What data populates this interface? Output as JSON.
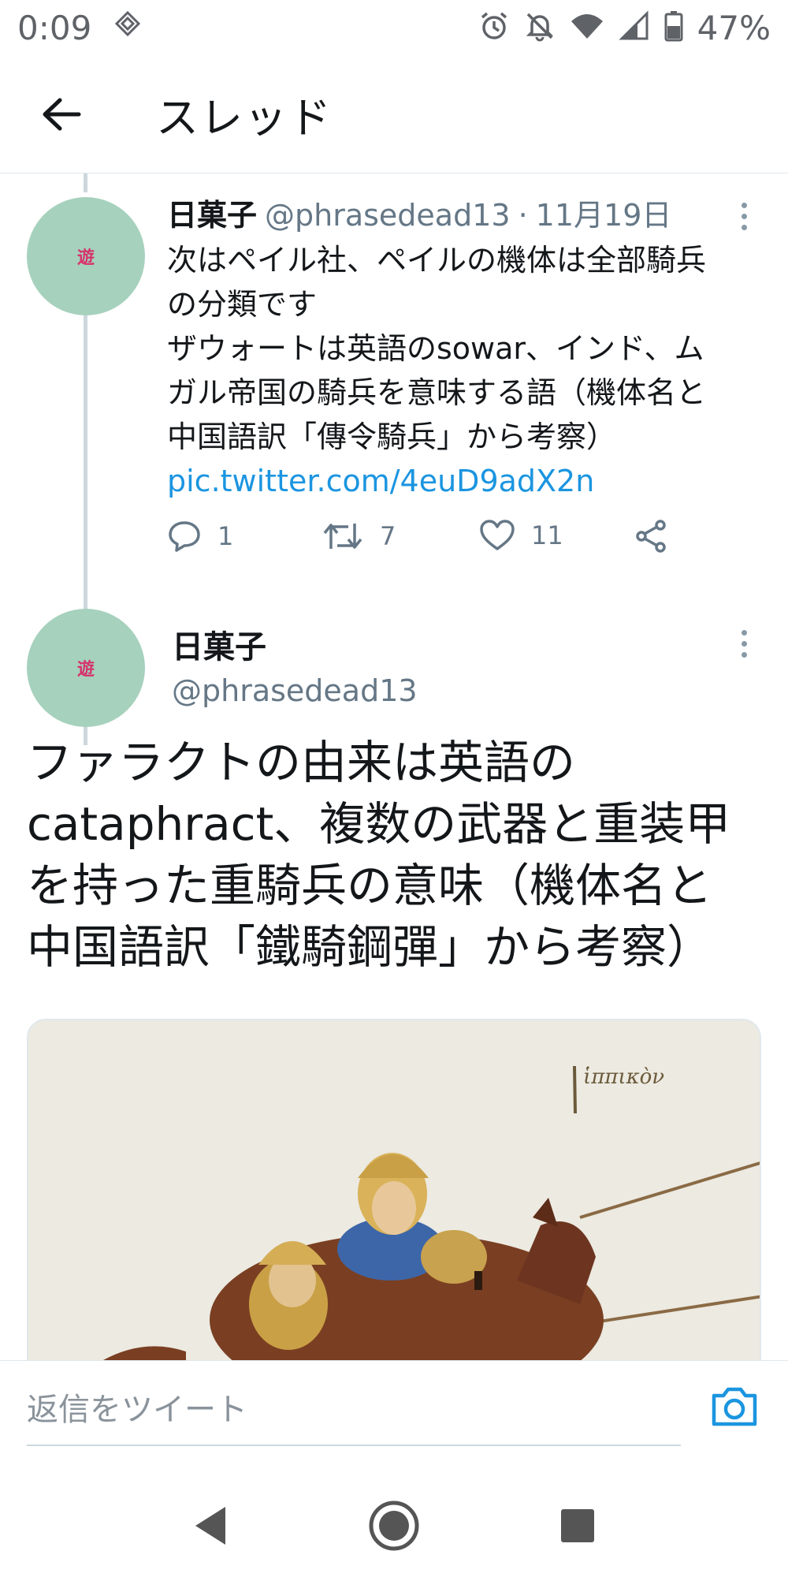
{
  "status_bar": {
    "time": "0:09",
    "battery": "47%",
    "icons": [
      "nfc-icon",
      "alarm-icon",
      "notifications-off-icon",
      "wifi-icon",
      "signal-icon",
      "battery-icon"
    ]
  },
  "header": {
    "title": "スレッド",
    "back_icon": "arrow-left-icon"
  },
  "tweets": [
    {
      "display_name": "日菓子",
      "handle": "@phrasedead13",
      "separator": "·",
      "date": "11月19日",
      "avatar_mark": "遊",
      "text_lines": [
        "次はペイル社、ペイルの機体は全部騎兵",
        "の分類です",
        "ザウォートは英語のsowar、インド、ム",
        "ガル帝国の騎兵を意味する語（機体名と",
        "中国語訳「傳令騎兵」から考察）"
      ],
      "link": "pic.twitter.com/4euD9adX2n",
      "replies": "1",
      "retweets": "7",
      "likes": "11"
    },
    {
      "display_name": "日菓子",
      "handle": "@phrasedead13",
      "avatar_mark": "遊",
      "text_lines": [
        "ファラクトの由来は英語の",
        "cataphract、複数の武器と重装甲",
        "を持った重騎兵の意味（機体名と",
        "中国語訳「鐵騎鋼彈」から考察）"
      ],
      "media_text": "ἱππικὸν"
    }
  ],
  "reply": {
    "placeholder": "返信をツイート"
  },
  "colors": {
    "link": "#1b95e0",
    "avatar_bg": "#a6d1bd",
    "secondary_text": "#657786",
    "divider": "#e1e8ed"
  }
}
